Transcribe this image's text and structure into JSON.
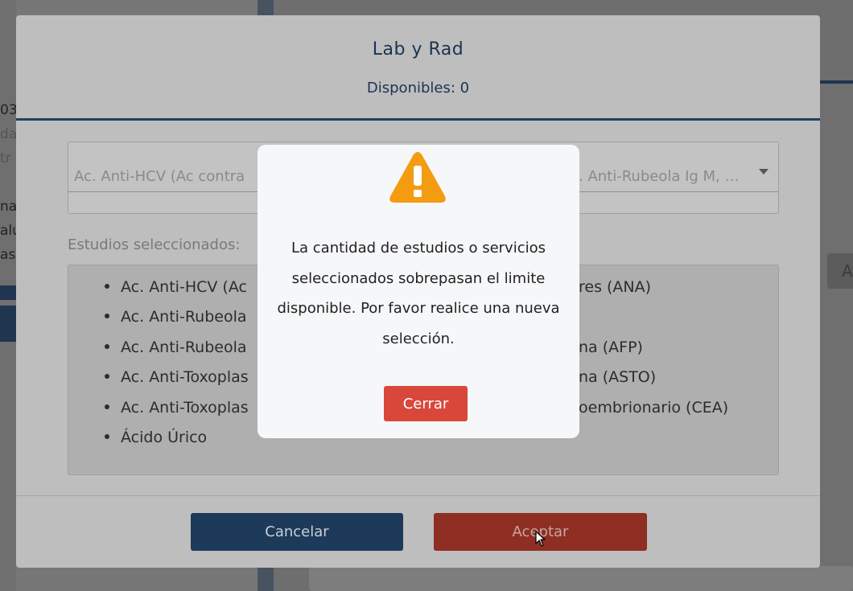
{
  "modal": {
    "title": "Lab y Rad",
    "subtitle": "Disponibles: 0",
    "select": {
      "value_left": "Ac. Anti-HCV (Ac contra",
      "value_right": ". Anti-Rubeola Ig M, …"
    },
    "selected_label": "Estudios seleccionados:",
    "studies_left": [
      "Ac. Anti-HCV (Ac",
      "Ac. Anti-Rubeola",
      "Ac. Anti-Rubeola",
      "Ac. Anti-Toxoplas",
      "Ac. Anti-Toxoplas",
      "Ácido Úrico"
    ],
    "studies_right": [
      "res (ANA)",
      "na (AFP)",
      "na (ASTO)",
      "oembrionario (CEA)"
    ],
    "cancel_label": "Cancelar",
    "accept_label": "Aceptar"
  },
  "alert": {
    "icon": "warning-triangle-icon",
    "icon_color": "#f39c12",
    "message": "La cantidad de estudios o servicios seleccionados sobrepasan el limite disponible. Por favor realice una nueva selección.",
    "close_label": "Cerrar"
  },
  "background": {
    "left_texts": [
      "03",
      "da",
      "tr",
      "na",
      "alu",
      "as"
    ],
    "right_button_label": "A"
  },
  "colors": {
    "primary": "#1e3a5a",
    "danger": "#d9473a",
    "warning": "#f39c12"
  }
}
